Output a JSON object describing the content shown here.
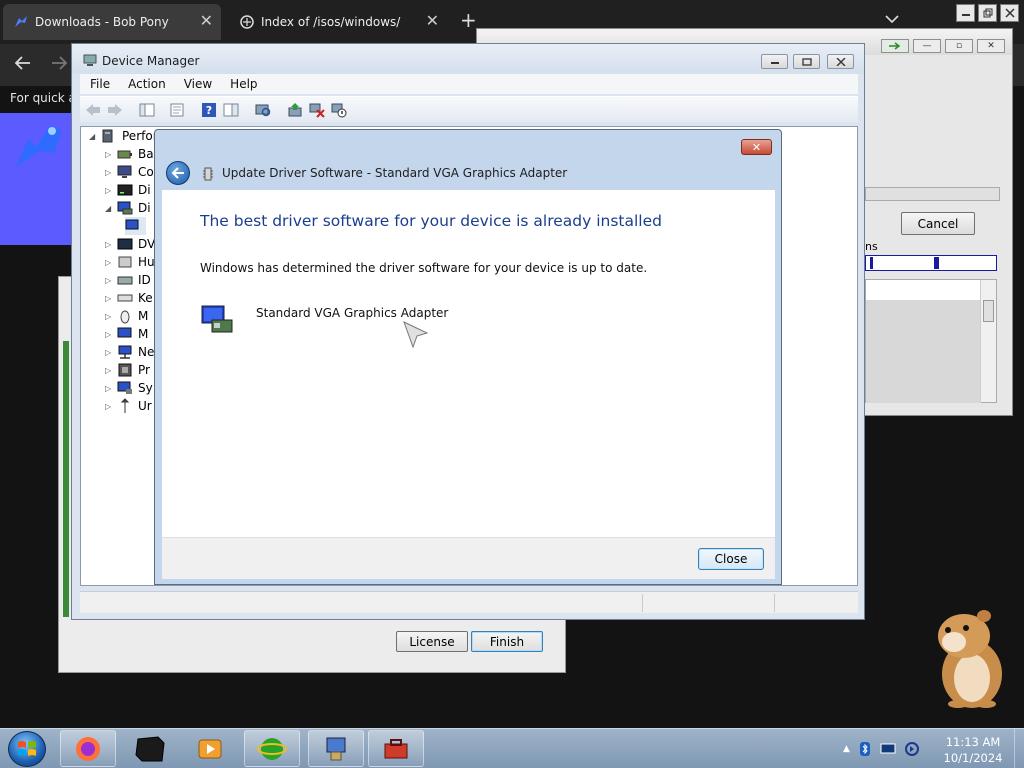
{
  "browser": {
    "tabs": [
      {
        "label": "Downloads - Bob Pony",
        "icon": "bob-pony-icon",
        "active": true
      },
      {
        "label": "Index of /isos/windows/",
        "icon": "server-icon",
        "active": false
      }
    ],
    "new_tab": "+",
    "bookmarks_text": "For quick ac",
    "close_glyph": "✕"
  },
  "device_manager": {
    "title": "Device Manager",
    "menu": [
      "File",
      "Action",
      "View",
      "Help"
    ],
    "tree": {
      "root_label": "Perfor",
      "items": [
        {
          "label": "Ba",
          "icon": "battery-icon",
          "expander": "▷"
        },
        {
          "label": "Co",
          "icon": "computer-icon",
          "expander": "▷"
        },
        {
          "label": "Di",
          "icon": "disk-drive-icon",
          "expander": "▷"
        },
        {
          "label": "Di",
          "icon": "display-adapter-icon",
          "expander": "◢"
        },
        {
          "label": "",
          "icon": "monitor-icon",
          "expander": ""
        },
        {
          "label": "DV",
          "icon": "dvd-drive-icon",
          "expander": "▷"
        },
        {
          "label": "Hu",
          "icon": "hid-icon",
          "expander": "▷"
        },
        {
          "label": "ID",
          "icon": "ide-controller-icon",
          "expander": "▷"
        },
        {
          "label": "Ke",
          "icon": "keyboard-icon",
          "expander": "▷"
        },
        {
          "label": "M",
          "icon": "mouse-icon",
          "expander": "▷"
        },
        {
          "label": "M",
          "icon": "monitors-icon",
          "expander": "▷"
        },
        {
          "label": "Ne",
          "icon": "network-icon",
          "expander": "▷"
        },
        {
          "label": "Pr",
          "icon": "processor-icon",
          "expander": "▷"
        },
        {
          "label": "Sy",
          "icon": "system-devices-icon",
          "expander": "▷"
        },
        {
          "label": "Ur",
          "icon": "usb-icon",
          "expander": "▷"
        }
      ]
    }
  },
  "wizard": {
    "header": "Update Driver Software - Standard VGA Graphics Adapter",
    "title": "The best driver software for your device is already installed",
    "description": "Windows has determined the driver software for your device is up to date.",
    "device_name": "Standard VGA Graphics Adapter",
    "close_button": "Close",
    "close_glyph": "✕"
  },
  "background_dialog": {
    "cancel_button": "Cancel",
    "partial_label": "ns"
  },
  "installer": {
    "license_button": "License",
    "finish_button": "Finish"
  },
  "taskbar": {
    "time": "11:13 AM",
    "date": "10/1/2024",
    "tray_overflow": "▲"
  },
  "colors": {
    "wizard_title": "#1a3e8e",
    "browser_accent": "#5b5bff",
    "close_red": "#c74b36"
  }
}
